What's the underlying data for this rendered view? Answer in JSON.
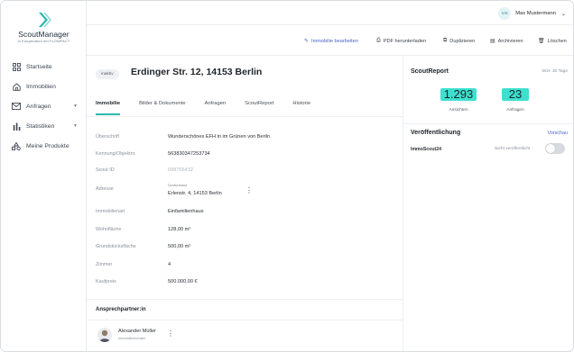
{
  "brand": {
    "name": "ScoutManager",
    "tagline": "in Kooperation mit FLOWFACT",
    "accent_color": "#2db7b0"
  },
  "sidebar": {
    "items": [
      {
        "label": "Startseite",
        "icon": "grid-icon"
      },
      {
        "label": "Immobilien",
        "icon": "house-icon"
      },
      {
        "label": "Anfragen",
        "icon": "mail-icon",
        "expandable": true
      },
      {
        "label": "Statistiken",
        "icon": "bar-chart-icon",
        "expandable": true
      },
      {
        "label": "Meine Produkte",
        "icon": "shapes-icon"
      }
    ]
  },
  "user": {
    "initials": "MB",
    "name": "Max Mustermann"
  },
  "actions": {
    "edit": "Immobilie bearbeiten",
    "pdf": "PDF herunterladen",
    "duplicate": "Duplizieren",
    "archive": "Archivieren",
    "delete": "Löschen"
  },
  "property": {
    "status": "inaktiv",
    "title": "Erdinger Str. 12, 14153 Berlin"
  },
  "tabs": [
    "Immobilie",
    "Bilder & Dokumente",
    "Anfragen",
    "ScoutReport",
    "Historie"
  ],
  "details": {
    "ueberschrift_label": "Überschrift",
    "ueberschrift": "Wunderschönes EFH in im Grünen von Berlin",
    "kennung_label": "Kennung/Objektnr.",
    "kennung": "563830347253734",
    "scout_id_label": "Scout ID",
    "scout_id": "098765432",
    "adresse_label": "Adresse",
    "adresse_country": "Deutschland",
    "adresse": "Erlenstr. 4, 14153 Berlin",
    "art_label": "Immobilienart",
    "art": "Einfamilienhaus",
    "wohnflaeche_label": "Wohnfläche",
    "wohnflaeche": "128,00 m²",
    "grundstueck_label": "Grundstücksfläche",
    "grundstueck": "500,00 m²",
    "zimmer_label": "Zimmer",
    "zimmer": "4",
    "kaufpreis_label": "Kaufpreis",
    "kaufpreis": "500.000,00 €"
  },
  "contact": {
    "heading": "Ansprechpartner:in",
    "name": "Alexander Müller",
    "role": "Immobilienberater"
  },
  "scoutreport": {
    "title": "ScoutReport",
    "period": "letzt. 30 Tage",
    "views_value": "1.293",
    "views_label": "Ansichten",
    "requests_value": "23",
    "requests_label": "Anfragen",
    "highlight_color": "#3de0cf"
  },
  "publication": {
    "title": "Veröffentlichung",
    "preview": "Vorschau",
    "portal": "ImmoScout24",
    "status": "Nicht veröffentlicht",
    "published": false
  }
}
